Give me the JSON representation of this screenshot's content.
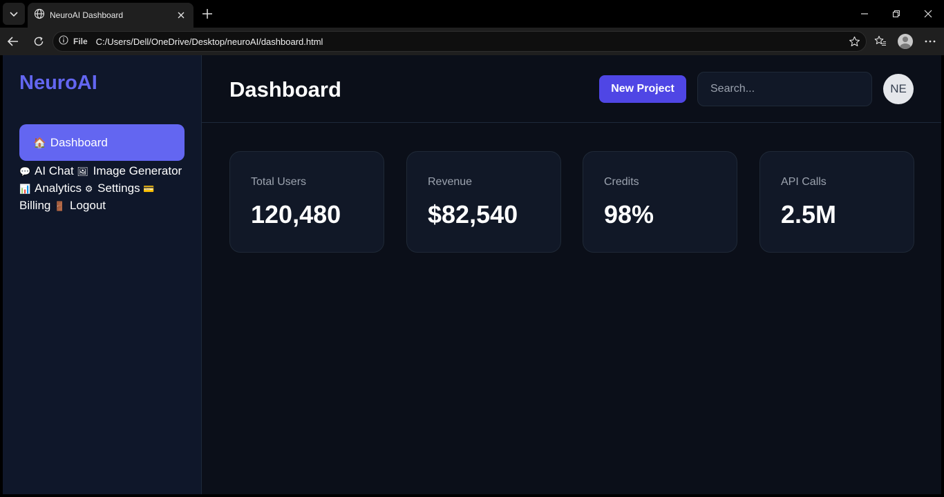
{
  "browser": {
    "tab_title": "NeuroAI Dashboard",
    "url_scheme_label": "File",
    "url": "C:/Users/Dell/OneDrive/Desktop/neuroAI/dashboard.html"
  },
  "sidebar": {
    "brand": "NeuroAI",
    "active_item": {
      "icon": "🏠",
      "label": "Dashboard"
    },
    "items": [
      {
        "icon": "💬",
        "label": "AI Chat"
      },
      {
        "icon": "🖼",
        "label": "Image Generator"
      },
      {
        "icon": "📊",
        "label": "Analytics"
      },
      {
        "icon": "⚙",
        "label": "Settings"
      },
      {
        "icon": "💳",
        "label": "Billing"
      },
      {
        "icon": "🚪",
        "label": "Logout"
      }
    ]
  },
  "header": {
    "title": "Dashboard",
    "new_project_label": "New Project",
    "search_placeholder": "Search...",
    "avatar_initials": "NE"
  },
  "stats": [
    {
      "label": "Total Users",
      "value": "120,480"
    },
    {
      "label": "Revenue",
      "value": "$82,540"
    },
    {
      "label": "Credits",
      "value": "98%"
    },
    {
      "label": "API Calls",
      "value": "2.5M"
    }
  ],
  "colors": {
    "accent": "#6366f1",
    "button": "#4f46e5",
    "sidebar_bg": "#0f172a",
    "main_bg": "#0b0f19",
    "card_bg": "#111827"
  }
}
